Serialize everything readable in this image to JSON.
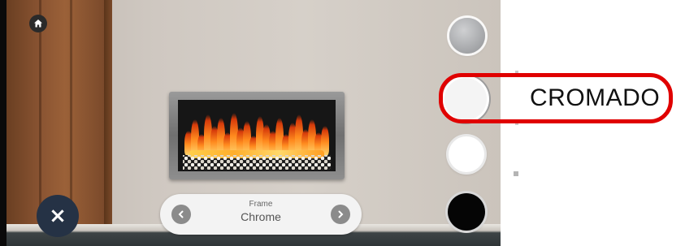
{
  "frame_selector": {
    "label": "Frame",
    "value": "Chrome",
    "prev_icon": "chevron-left-icon",
    "next_icon": "chevron-right-icon"
  },
  "controls": {
    "home_icon": "home-icon",
    "close_icon": "close-icon",
    "close_glyph": "×"
  },
  "swatches": [
    {
      "name": "silver",
      "color": "#a9a9ab",
      "selected": false
    },
    {
      "name": "chrome",
      "color": "#f2f2f2",
      "selected": true
    },
    {
      "name": "white",
      "color": "#ffffff",
      "selected": false
    },
    {
      "name": "black",
      "color": "#050505",
      "selected": false
    }
  ],
  "annotation": {
    "label": "CROMADO",
    "color": "#e00000"
  }
}
